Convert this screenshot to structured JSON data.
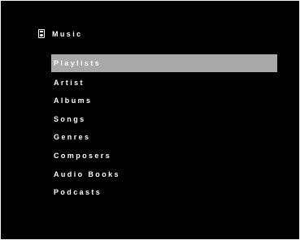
{
  "header": {
    "title": "Music",
    "icon": "ipod-icon"
  },
  "menu": {
    "items": [
      {
        "label": "Playlists",
        "selected": true
      },
      {
        "label": "Artist",
        "selected": false
      },
      {
        "label": "Albums",
        "selected": false
      },
      {
        "label": "Songs",
        "selected": false
      },
      {
        "label": "Genres",
        "selected": false
      },
      {
        "label": "Composers",
        "selected": false
      },
      {
        "label": "Audio Books",
        "selected": false
      },
      {
        "label": "Podcasts",
        "selected": false
      }
    ]
  },
  "colors": {
    "background": "#000000",
    "text": "#ffffff",
    "highlight": "#a9a9a9"
  }
}
